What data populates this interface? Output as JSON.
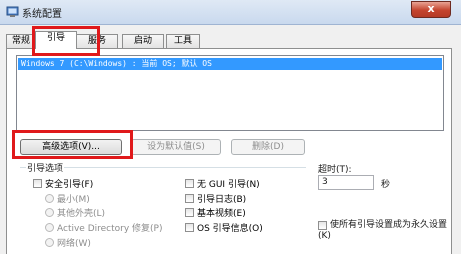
{
  "window": {
    "title": "系统配置",
    "close_label": "x"
  },
  "tabs": [
    {
      "label": "常规",
      "active": false
    },
    {
      "label": "引导",
      "active": true
    },
    {
      "label": "服务",
      "active": false
    },
    {
      "label": "启动",
      "active": false
    },
    {
      "label": "工具",
      "active": false
    }
  ],
  "boot": {
    "os_entries": [
      "Windows 7 (C:\\Windows) : 当前 OS; 默认 OS"
    ],
    "buttons": {
      "advanced": "高级选项(V)...",
      "set_default": "设为默认值(S)",
      "delete": "删除(D)"
    },
    "options_group": "引导选项",
    "safe_boot": "安全引导(F)",
    "minimal": "最小(M)",
    "alternate_shell": "其他外壳(L)",
    "active_directory": "Active Directory 修复(P)",
    "network": "网络(W)",
    "no_gui": "无 GUI 引导(N)",
    "boot_log": "引导日志(B)",
    "base_video": "基本视频(E)",
    "os_boot_info": "OS 引导信息(O)",
    "timeout_label": "超时(T):",
    "timeout_value": "3",
    "timeout_unit": "秒",
    "make_permanent": "使所有引导设置成为永久设置(K)"
  },
  "annotation_color": "#e0191b"
}
